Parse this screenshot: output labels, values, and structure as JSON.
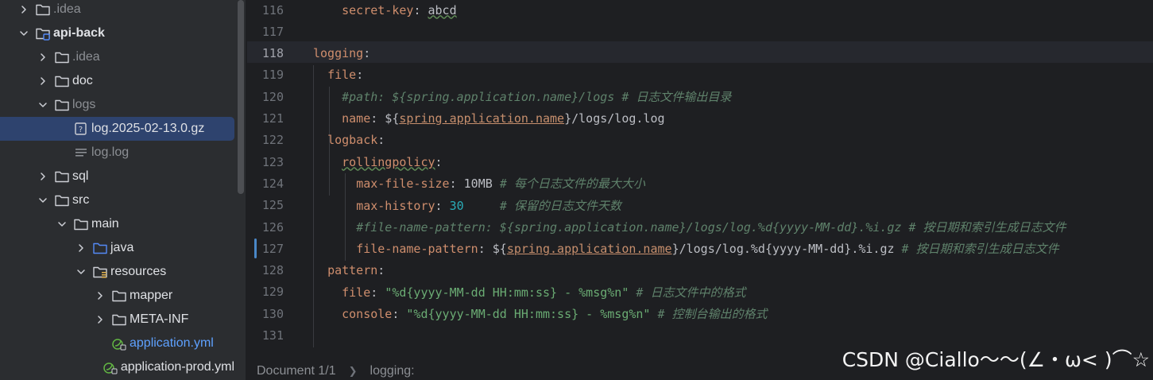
{
  "tree": [
    {
      "indent": 0,
      "chevron": "right",
      "icon": "folder",
      "label": ".idea",
      "style": "dim"
    },
    {
      "indent": 0,
      "chevron": "down",
      "icon": "module-folder",
      "label": "api-back",
      "style": "bold"
    },
    {
      "indent": 1,
      "chevron": "right",
      "icon": "folder",
      "label": ".idea",
      "style": "dim"
    },
    {
      "indent": 1,
      "chevron": "right",
      "icon": "folder",
      "label": "doc",
      "style": ""
    },
    {
      "indent": 1,
      "chevron": "down",
      "icon": "folder",
      "label": "logs",
      "style": "dim"
    },
    {
      "indent": 2,
      "chevron": "none",
      "icon": "unknown-file",
      "label": "log.2025-02-13.0.gz",
      "style": "",
      "selected": true
    },
    {
      "indent": 2,
      "chevron": "none",
      "icon": "text-file",
      "label": "log.log",
      "style": "dim"
    },
    {
      "indent": 1,
      "chevron": "right",
      "icon": "folder",
      "label": "sql",
      "style": ""
    },
    {
      "indent": 1,
      "chevron": "down",
      "icon": "folder",
      "label": "src",
      "style": ""
    },
    {
      "indent": 2,
      "chevron": "down",
      "icon": "folder",
      "label": "main",
      "style": ""
    },
    {
      "indent": 3,
      "chevron": "right",
      "icon": "source-folder",
      "label": "java",
      "style": ""
    },
    {
      "indent": 3,
      "chevron": "down",
      "icon": "resources-folder",
      "label": "resources",
      "style": ""
    },
    {
      "indent": 4,
      "chevron": "right",
      "icon": "folder",
      "label": "mapper",
      "style": ""
    },
    {
      "indent": 4,
      "chevron": "right",
      "icon": "folder",
      "label": "META-INF",
      "style": ""
    },
    {
      "indent": 4,
      "chevron": "none",
      "icon": "spring-yml",
      "label": "application.yml",
      "style": "blue"
    },
    {
      "indent": 4,
      "chevron": "none",
      "icon": "spring-yml",
      "label": "application-prod.yml",
      "style": ""
    }
  ],
  "editor": {
    "current_line": "118",
    "lines": [
      {
        "num": "116",
        "segs": [
          {
            "t": "    "
          },
          {
            "t": "secret-key",
            "c": "k"
          },
          {
            "t": ": "
          },
          {
            "t": "abcd",
            "c": "v wavy"
          }
        ]
      },
      {
        "num": "117",
        "segs": []
      },
      {
        "num": "118",
        "segs": [
          {
            "t": "logging",
            "c": "k"
          },
          {
            "t": ":"
          }
        ]
      },
      {
        "num": "119",
        "segs": [
          {
            "t": "  "
          },
          {
            "t": "file",
            "c": "k"
          },
          {
            "t": ":"
          }
        ]
      },
      {
        "num": "120",
        "segs": [
          {
            "t": "    "
          },
          {
            "t": "#path: ${spring.application.name}/logs # 日志文件输出目录",
            "c": "c"
          }
        ]
      },
      {
        "num": "121",
        "segs": [
          {
            "t": "    "
          },
          {
            "t": "name",
            "c": "k"
          },
          {
            "t": ": ${"
          },
          {
            "t": "spring.application.name",
            "c": "uo"
          },
          {
            "t": "}/logs/log.log"
          }
        ]
      },
      {
        "num": "122",
        "segs": [
          {
            "t": "  "
          },
          {
            "t": "logback",
            "c": "k"
          },
          {
            "t": ":"
          }
        ]
      },
      {
        "num": "123",
        "segs": [
          {
            "t": "    "
          },
          {
            "t": "rollingpolicy",
            "c": "k wavy"
          },
          {
            "t": ":"
          }
        ]
      },
      {
        "num": "124",
        "segs": [
          {
            "t": "      "
          },
          {
            "t": "max-file-size",
            "c": "k"
          },
          {
            "t": ": 10MB "
          },
          {
            "t": "# 每个日志文件的最大大小",
            "c": "c"
          }
        ]
      },
      {
        "num": "125",
        "segs": [
          {
            "t": "      "
          },
          {
            "t": "max-history",
            "c": "k"
          },
          {
            "t": ": "
          },
          {
            "t": "30",
            "c": "n"
          },
          {
            "t": "     "
          },
          {
            "t": "# 保留的日志文件天数",
            "c": "c"
          }
        ]
      },
      {
        "num": "126",
        "segs": [
          {
            "t": "      "
          },
          {
            "t": "#file-name-pattern: ${spring.application.name}/logs/log.%d{yyyy-MM-dd}.%i.gz # 按日期和索引生成日志文件",
            "c": "c"
          }
        ]
      },
      {
        "num": "127",
        "segs": [
          {
            "t": "      "
          },
          {
            "t": "file-name-pattern",
            "c": "k"
          },
          {
            "t": ": ${"
          },
          {
            "t": "spring.application.name",
            "c": "uo"
          },
          {
            "t": "}/logs/log.%d{yyyy-MM-dd}.%i.gz "
          },
          {
            "t": "# 按日期和索引生成日志文件",
            "c": "c"
          }
        ]
      },
      {
        "num": "128",
        "segs": [
          {
            "t": "  "
          },
          {
            "t": "pattern",
            "c": "k"
          },
          {
            "t": ":"
          }
        ]
      },
      {
        "num": "129",
        "segs": [
          {
            "t": "    "
          },
          {
            "t": "file",
            "c": "k"
          },
          {
            "t": ": "
          },
          {
            "t": "\"%d{yyyy-MM-dd HH:mm:ss} - %msg%n\"",
            "c": "s"
          },
          {
            "t": " "
          },
          {
            "t": "# 日志文件中的格式",
            "c": "c"
          }
        ]
      },
      {
        "num": "130",
        "segs": [
          {
            "t": "    "
          },
          {
            "t": "console",
            "c": "k"
          },
          {
            "t": ": "
          },
          {
            "t": "\"%d{yyyy-MM-dd HH:mm:ss} - %msg%n\"",
            "c": "s"
          },
          {
            "t": " "
          },
          {
            "t": "# 控制台输出的格式",
            "c": "c"
          }
        ]
      },
      {
        "num": "131",
        "segs": []
      }
    ]
  },
  "breadcrumb": {
    "document": "Document 1/1",
    "path": "logging:"
  },
  "watermark": "CSDN @Ciallo～～(∠・ω< )⌒☆",
  "colors": {
    "sidebar_bg": "#2b2d30",
    "editor_bg": "#1e1f22",
    "selection": "#2e436e",
    "key": "#cf8e6d",
    "comment": "#5f826b",
    "string": "#6aab73",
    "number": "#2aacb8"
  }
}
